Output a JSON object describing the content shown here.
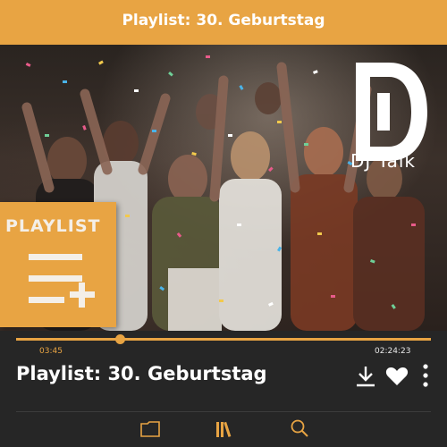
{
  "header": {
    "title": "Playlist: 30. Geburtstag"
  },
  "cover": {
    "logo_text": "DJ Talk",
    "badge_label": "PLAYLIST",
    "badge_icon": "playlist-add-icon"
  },
  "player": {
    "current_time": "03:45",
    "total_time": "02:24:23",
    "progress": 0.25,
    "track_title": "Playlist: 30. Geburtstag",
    "actions": [
      "download-icon",
      "heart-icon",
      "more-vertical-icon"
    ]
  },
  "nav": {
    "items": [
      "folder-icon",
      "library-icon",
      "search-icon"
    ]
  },
  "colors": {
    "accent": "#e8a443",
    "background": "#262626",
    "text": "#ffffff"
  }
}
